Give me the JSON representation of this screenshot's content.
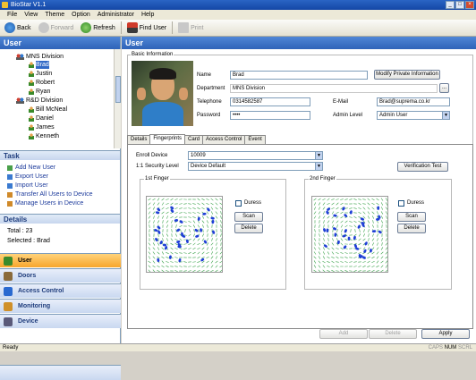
{
  "window": {
    "title": "BioStar V1.1"
  },
  "menu": [
    "File",
    "View",
    "Theme",
    "Option",
    "Administrator",
    "Help"
  ],
  "toolbar": {
    "back": "Back",
    "forward": "Forward",
    "refresh": "Refresh",
    "find_user": "Find User",
    "print": "Print"
  },
  "left": {
    "header": "User",
    "tree": [
      {
        "label": "MNS Division",
        "type": "group"
      },
      {
        "label": "Brad",
        "type": "user",
        "selected": true
      },
      {
        "label": "Justin",
        "type": "user"
      },
      {
        "label": "Robert",
        "type": "user"
      },
      {
        "label": "Ryan",
        "type": "user"
      },
      {
        "label": "R&D Division",
        "type": "group"
      },
      {
        "label": "Bill McNeal",
        "type": "user"
      },
      {
        "label": "Daniel",
        "type": "user"
      },
      {
        "label": "James",
        "type": "user"
      },
      {
        "label": "Kenneth",
        "type": "user"
      }
    ],
    "task_header": "Task",
    "tasks": [
      "Add New User",
      "Export User",
      "Import User",
      "Transfer All Users to Device",
      "Manage Users in Device"
    ],
    "details_header": "Details",
    "details": {
      "total": "Total : 23",
      "selected": "Selected : Brad"
    },
    "nav": [
      "User",
      "Doors",
      "Access Control",
      "Monitoring",
      "Device"
    ]
  },
  "right": {
    "header": "User",
    "basic_legend": "Basic Information",
    "fields": {
      "name_label": "Name",
      "name_value": "Brad",
      "department_label": "Department",
      "department_value": "MNS Division",
      "telephone_label": "Telephone",
      "telephone_value": "0314582587",
      "password_label": "Password",
      "password_value": "••••",
      "email_label": "E-Mail",
      "email_value": "Brad@suprema.co.kr",
      "admin_label": "Admin Level",
      "admin_value": "Admin User"
    },
    "modify_button": "Modify Private Information",
    "browse_button": "...",
    "tabs": [
      "Details",
      "Fingerprints",
      "Card",
      "Access Control",
      "Event"
    ],
    "active_tab": "Fingerprints",
    "fingerprints": {
      "enroll_label": "Enroll Device",
      "enroll_value": "10009",
      "security_label": "1:1 Security Level",
      "security_value": "Device Default",
      "verify_button": "Verification Test",
      "first_legend": "1st Finger",
      "second_legend": "2nd Finger",
      "duress_label": "Duress",
      "scan_button": "Scan",
      "delete_button": "Delete"
    },
    "bottom_buttons": {
      "add": "Add",
      "delete": "Delete",
      "apply": "Apply"
    }
  },
  "status": {
    "left": "Ready",
    "caps": "CAPS",
    "num": "NUM",
    "scrl": "SCRL"
  }
}
